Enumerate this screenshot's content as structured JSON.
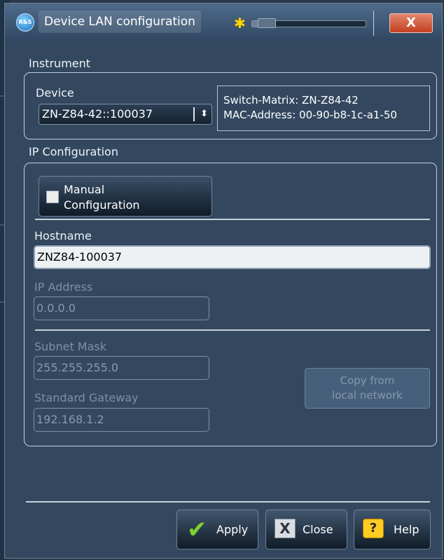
{
  "window": {
    "title": "Device LAN configuration",
    "close_symbol": "X",
    "icon_glyph": "R&S",
    "brightness_level": 0.08
  },
  "instrument": {
    "group_label": "Instrument",
    "device_label": "Device",
    "device_value": "ZN-Z84-42::100037",
    "info_line1": "Switch-Matrix: ZN-Z84-42",
    "info_line2": "MAC-Address: 00-90-b8-1c-a1-50"
  },
  "ip": {
    "group_label": "IP Configuration",
    "manual_line1": "Manual",
    "manual_line2": "Configuration",
    "manual_checked": false,
    "hostname_label": "Hostname",
    "hostname_value": "ZNZ84-100037",
    "ip_label": "IP Address",
    "ip_value": "0.0.0.0",
    "subnet_label": "Subnet Mask",
    "subnet_value": "255.255.255.0",
    "gateway_label": "Standard Gateway",
    "gateway_value": "192.168.1.2",
    "copy_line1": "Copy from",
    "copy_line2": "local network"
  },
  "footer": {
    "apply": "Apply",
    "close": "Close",
    "help": "Help",
    "help_icon_glyph": "?",
    "close_icon_glyph": "X"
  },
  "colors": {
    "accent_check": "#7fd12a",
    "close_red": "#c3401f",
    "help_yellow": "#ffcc22"
  }
}
